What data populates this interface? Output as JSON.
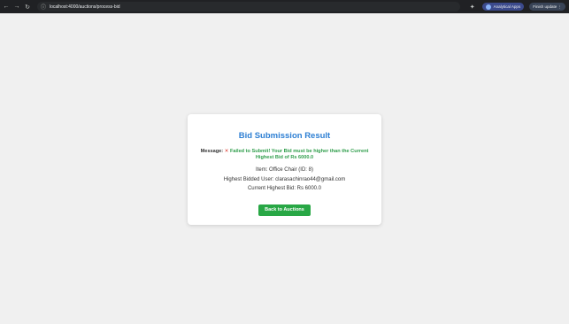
{
  "browser": {
    "url": "localhost:4000/auctions/process-bid",
    "profile_label": "Analytical Apps",
    "menu_label": "Finish update"
  },
  "result": {
    "title": "Bid Submission Result",
    "message_label": "Message:",
    "message_icon": "✕",
    "message_text": "Failed to Submit! Your Bid must be higher than the Current Highest Bid of Rs 6000.0",
    "item": "Item: Office Chair (ID: 8)",
    "highest_user": "Highest Bidded User: clarasachinrao44@gmail.com",
    "current_bid": "Current Highest Bid: Rs 6000.0",
    "back_button": "Back to Auctions"
  },
  "colors": {
    "title": "#2d7fd3",
    "success_text": "#2e9d4a",
    "error_icon": "#d93025",
    "button": "#28a745"
  }
}
